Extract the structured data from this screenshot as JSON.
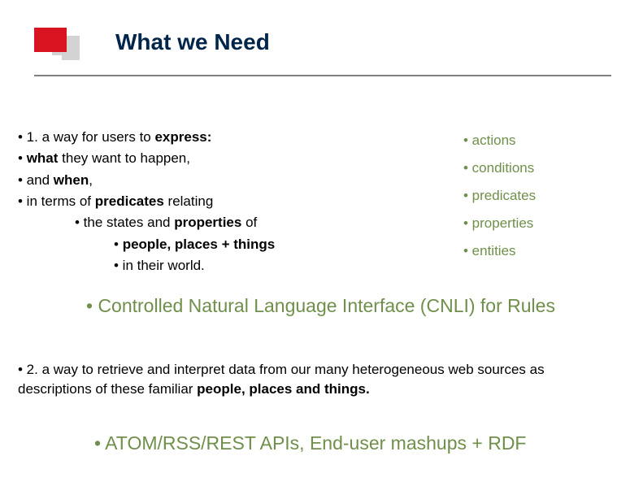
{
  "title": "What we Need",
  "left": {
    "l1_pre": "• 1. a way for users to ",
    "l1_b": "express:",
    "l2_pre": "•     ",
    "l2_b": "what",
    "l2_post": " they want to happen,",
    "l3_pre": "•     and ",
    "l3_b": "when",
    "l3_post": ",",
    "l4_pre": "•     in terms of ",
    "l4_b": "predicates",
    "l4_post": " relating",
    "l5_pre": "• the states and ",
    "l5_b": "properties",
    "l5_post": " of",
    "l6_pre": "• ",
    "l6_b": "people, places + things",
    "l7": "• in their world."
  },
  "right": {
    "r1": "• actions",
    "r2": "• conditions",
    "r3": "• predicates",
    "r4": "• properties",
    "r5": "• entities"
  },
  "cnli": "• Controlled Natural Language Interface (CNLI) for Rules",
  "point2": {
    "pre": "• 2. a way to retrieve and interpret data from our many heterogeneous web sources as descriptions of these familiar ",
    "b": "people, places and things."
  },
  "apis": "• ATOM/RSS/REST APIs, End-user mashups + RDF"
}
